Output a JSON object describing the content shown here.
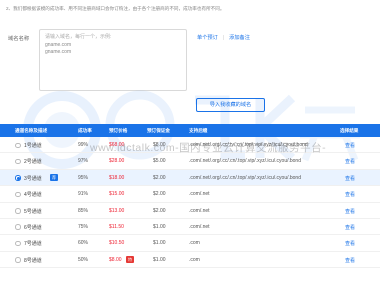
{
  "notice": "2、我们都根据该模的成功率、用不同注册商域口会你订购注，由于各个注册商的不同，成功率也有所不同。",
  "form": {
    "label": "域名名称",
    "placeholder_line1": "请输入域名，每行一个，示例:",
    "placeholder_line2": "gname.com",
    "placeholder_line3": "gname.com",
    "link_single": "单个预订",
    "link_remark": "添加备注",
    "import_button": "导入我收藏的域名"
  },
  "watermark": {
    "text": "www.idctalk.com-国内专业云计算交流服务平台-"
  },
  "table": {
    "headers": [
      "通道名称及描述",
      "成功率",
      "预订价格",
      "预订保证金",
      "支持后缀",
      "选择结果"
    ],
    "rows": [
      {
        "name": "1号通道",
        "rate": "99%",
        "price": "$68.00",
        "deposit": "$8.00",
        "suffix": ".com/.net/.org/.cc/.tv/.cn/.top/.vip/.xyz/.icu/.cyou/.bond",
        "action": "查看",
        "selected": false,
        "tag": ""
      },
      {
        "name": "2号通道",
        "rate": "97%",
        "price": "$28.00",
        "deposit": "$5.00",
        "suffix": ".com/.net/.org/.cc/.cn/.top/.vip/.xyz/.icu/.cyou/.bond",
        "action": "查看",
        "selected": false,
        "tag": ""
      },
      {
        "name": "3号通道",
        "rate": "95%",
        "price": "$18.00",
        "deposit": "$2.00",
        "suffix": ".com/.net/.org/.cc/.cn/.top/.vip/.xyz/.icu/.cyou/.bond",
        "action": "查看",
        "selected": true,
        "tag": "荐"
      },
      {
        "name": "4号通道",
        "rate": "91%",
        "price": "$15.00",
        "deposit": "$2.00",
        "suffix": ".com/.net",
        "action": "查看",
        "selected": false,
        "tag": ""
      },
      {
        "name": "5号通道",
        "rate": "85%",
        "price": "$13.00",
        "deposit": "$2.00",
        "suffix": ".com/.net",
        "action": "查看",
        "selected": false,
        "tag": ""
      },
      {
        "name": "6号通道",
        "rate": "75%",
        "price": "$11.50",
        "deposit": "$1.00",
        "suffix": ".com/.net",
        "action": "查看",
        "selected": false,
        "tag": ""
      },
      {
        "name": "7号通道",
        "rate": "60%",
        "price": "$10.50",
        "deposit": "$1.00",
        "suffix": ".com",
        "action": "查看",
        "selected": false,
        "tag": ""
      },
      {
        "name": "8号通道",
        "rate": "50%",
        "price": "$8.00",
        "deposit": "$1.00",
        "suffix": ".com",
        "action": "查看",
        "selected": false,
        "tag": "特"
      }
    ]
  },
  "colors": {
    "accent": "#1a73e8",
    "price": "#e23333",
    "selected_row": "#eaf3ff"
  }
}
